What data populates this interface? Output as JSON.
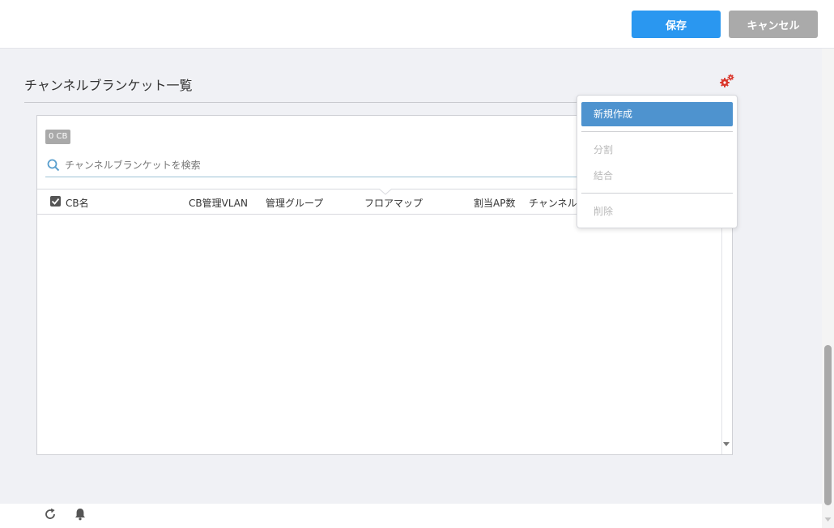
{
  "toolbar": {
    "save_label": "保存",
    "cancel_label": "キャンセル"
  },
  "section": {
    "title": "チャンネルブランケット一覧"
  },
  "panel": {
    "count_badge": "0 CB",
    "search_placeholder": "チャンネルブランケットを検索",
    "columns": [
      "CB名",
      "CB管理VLAN",
      "管理グループ",
      "フロアマップ",
      "割当AP数",
      "チャンネル"
    ]
  },
  "menu": {
    "items": [
      {
        "label": "新規作成",
        "state": "active"
      },
      {
        "label": "分割",
        "state": "disabled"
      },
      {
        "label": "結合",
        "state": "disabled"
      },
      {
        "label": "削除",
        "state": "disabled"
      }
    ]
  },
  "colors": {
    "primary": "#2a97f0",
    "cancel": "#aaaaaa",
    "menu_active": "#4e93cf",
    "gear_accent": "#d9352a"
  },
  "icons": {
    "gear": "gear-icon",
    "search": "search-icon",
    "refresh": "refresh-icon",
    "notification": "bell-icon"
  }
}
